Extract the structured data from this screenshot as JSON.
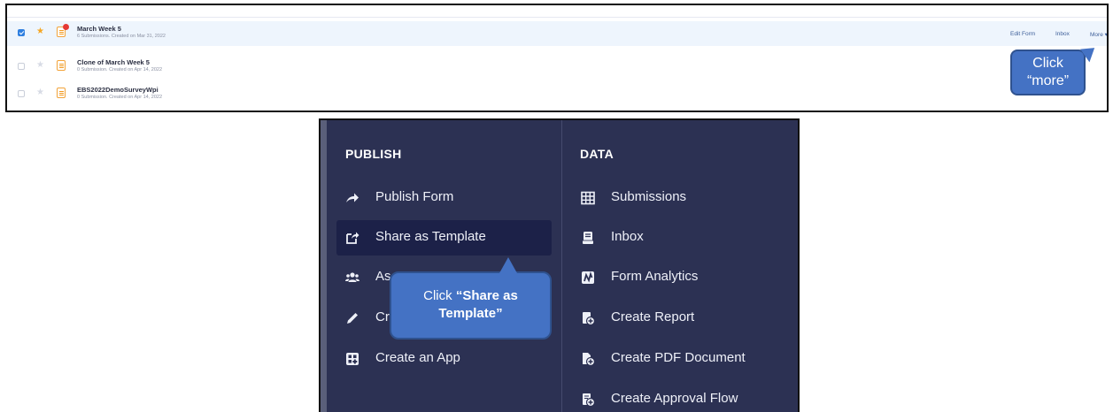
{
  "form_list": {
    "rows": [
      {
        "name": "March Week 5",
        "meta": "6 Submissions. Created on Mar 31, 2022",
        "checked": true,
        "starred": true
      },
      {
        "name": "Clone of March Week 5",
        "meta": "0 Submission. Created on Apr 14, 2022",
        "checked": false,
        "starred": false
      },
      {
        "name": "EBS2022DemoSurveyWpi",
        "meta": "0 Submission. Created on Apr 14, 2022",
        "checked": false,
        "starred": false
      }
    ],
    "actions": {
      "edit_form": "Edit Form",
      "inbox": "Inbox",
      "more": "More ▾"
    },
    "callout": {
      "line1": "Click",
      "line2": "“more”"
    }
  },
  "menu": {
    "publish": {
      "title": "PUBLISH",
      "items": [
        {
          "label": "Publish Form",
          "icon": "arrow-share-icon"
        },
        {
          "label": "Share as Template",
          "icon": "share-template-icon"
        },
        {
          "label": "As",
          "icon": "people-icon"
        },
        {
          "label": "Cr",
          "icon": "pencil-icon"
        },
        {
          "label": "Create an App",
          "icon": "app-grid-icon"
        }
      ]
    },
    "data": {
      "title": "DATA",
      "items": [
        {
          "label": "Submissions",
          "icon": "table-icon"
        },
        {
          "label": "Inbox",
          "icon": "inbox-icon"
        },
        {
          "label": "Form Analytics",
          "icon": "analytics-icon"
        },
        {
          "label": "Create Report",
          "icon": "report-icon"
        },
        {
          "label": "Create PDF Document",
          "icon": "pdf-doc-icon"
        },
        {
          "label": "Create Approval Flow",
          "icon": "approval-icon"
        }
      ]
    },
    "callout": {
      "prefix": "Click ",
      "emph1": "“Share as",
      "emph2": "Template”"
    }
  },
  "colors": {
    "menu_bg": "#2c3153",
    "active_bg": "#1c2148",
    "callout": "#4472c4",
    "star": "#f5a623",
    "check": "#2f7fe0"
  }
}
